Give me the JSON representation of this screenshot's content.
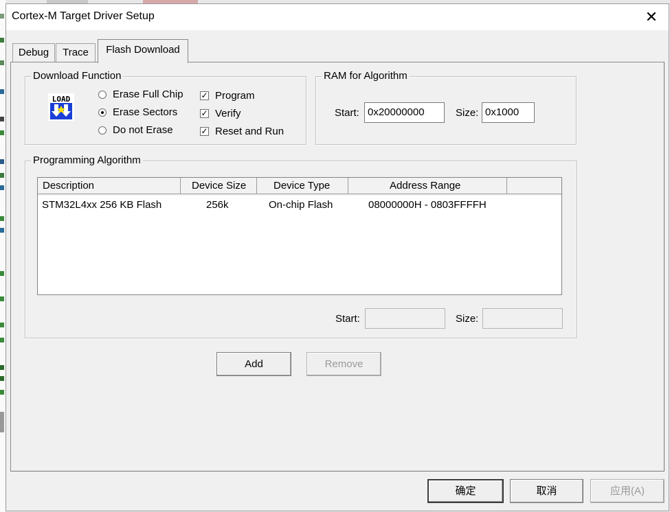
{
  "window": {
    "title": "Cortex-M Target Driver Setup",
    "close_glyph": "✕"
  },
  "tabs": [
    {
      "label": "Debug",
      "active": false
    },
    {
      "label": "Trace",
      "active": false
    },
    {
      "label": "Flash Download",
      "active": true
    }
  ],
  "download_function": {
    "label": "Download Function",
    "icon": "load-icon",
    "icon_text": "LOAD",
    "radios": [
      {
        "label": "Erase Full Chip",
        "selected": false
      },
      {
        "label": "Erase Sectors",
        "selected": true
      },
      {
        "label": "Do not Erase",
        "selected": false
      }
    ],
    "checks": [
      {
        "label": "Program",
        "checked": true
      },
      {
        "label": "Verify",
        "checked": true
      },
      {
        "label": "Reset and Run",
        "checked": true
      }
    ]
  },
  "ram": {
    "label": "RAM for Algorithm",
    "start_label": "Start:",
    "start_value": "0x20000000",
    "size_label": "Size:",
    "size_value": "0x1000"
  },
  "algorithm": {
    "label": "Programming Algorithm",
    "columns": [
      "Description",
      "Device Size",
      "Device Type",
      "Address Range"
    ],
    "rows": [
      {
        "description": "STM32L4xx 256 KB Flash",
        "device_size": "256k",
        "device_type": "On-chip Flash",
        "address_range": "08000000H - 0803FFFFH"
      }
    ],
    "start_label": "Start:",
    "start_value": "",
    "size_label": "Size:",
    "size_value": ""
  },
  "buttons": {
    "add": "Add",
    "remove": "Remove",
    "ok": "确定",
    "cancel": "取消",
    "apply": "应用(A)"
  },
  "colors": {
    "dialog_bg": "#f0f0f0",
    "icon_blue": "#1a3fd6",
    "icon_yellow": "#ffe400"
  }
}
